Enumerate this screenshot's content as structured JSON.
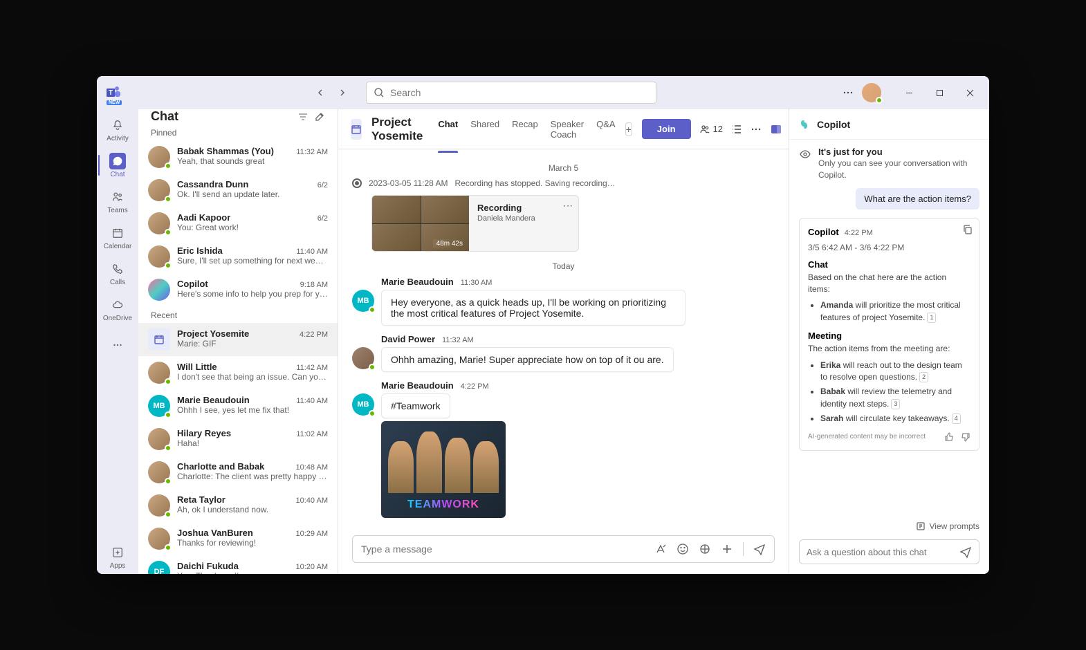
{
  "titlebar": {
    "search_placeholder": "Search",
    "new_badge": "NEW"
  },
  "rail": {
    "activity": "Activity",
    "chat": "Chat",
    "teams": "Teams",
    "calendar": "Calendar",
    "calls": "Calls",
    "onedrive": "OneDrive",
    "apps": "Apps"
  },
  "chatlist": {
    "title": "Chat",
    "sections": {
      "pinned": "Pinned",
      "recent": "Recent"
    },
    "pinned": [
      {
        "name": "Babak Shammas (You)",
        "time": "11:32 AM",
        "preview": "Yeah, that sounds great"
      },
      {
        "name": "Cassandra Dunn",
        "time": "6/2",
        "preview": "Ok. I'll send an update later."
      },
      {
        "name": "Aadi Kapoor",
        "time": "6/2",
        "preview": "You: Great work!"
      },
      {
        "name": "Eric Ishida",
        "time": "11:40 AM",
        "preview": "Sure, I'll set up something for next week t…"
      },
      {
        "name": "Copilot",
        "time": "9:18 AM",
        "preview": "Here's some info to help you prep for your…"
      }
    ],
    "recent": [
      {
        "name": "Project Yosemite",
        "time": "4:22 PM",
        "preview": "Marie: GIF"
      },
      {
        "name": "Will Little",
        "time": "11:42 AM",
        "preview": "I don't see that being an issue. Can you ta…"
      },
      {
        "name": "Marie Beaudouin",
        "time": "11:40 AM",
        "preview": "Ohhh I see, yes let me fix that!",
        "initials": "MB"
      },
      {
        "name": "Hilary Reyes",
        "time": "11:02 AM",
        "preview": "Haha!"
      },
      {
        "name": "Charlotte and Babak",
        "time": "10:48 AM",
        "preview": "Charlotte: The client was pretty happy with…"
      },
      {
        "name": "Reta Taylor",
        "time": "10:40 AM",
        "preview": "Ah, ok I understand now."
      },
      {
        "name": "Joshua VanBuren",
        "time": "10:29 AM",
        "preview": "Thanks for reviewing!"
      },
      {
        "name": "Daichi Fukuda",
        "time": "10:20 AM",
        "preview": "You: Thank you!!",
        "initials": "DF"
      }
    ]
  },
  "main": {
    "title": "Project Yosemite",
    "tabs": {
      "chat": "Chat",
      "shared": "Shared",
      "recap": "Recap",
      "coach": "Speaker Coach",
      "qa": "Q&A"
    },
    "join": "Join",
    "participant_count": "12",
    "date_march": "March 5",
    "date_today": "Today",
    "recording": {
      "timestamp": "2023-03-05 11:28 AM",
      "status": "Recording has stopped. Saving recording…",
      "title": "Recording",
      "author": "Daniela Mandera",
      "duration": "48m 42s"
    },
    "messages": [
      {
        "sender": "Marie Beaudouin",
        "time": "11:30 AM",
        "text": "Hey everyone, as a quick heads up, I'll be working on prioritizing the most critical features of Project Yosemite.",
        "avatar": "MB"
      },
      {
        "sender": "David Power",
        "time": "11:32 AM",
        "text": "Ohhh amazing, Marie! Super appreciate how on top of it ou are."
      },
      {
        "sender": "Marie Beaudouin",
        "time": "4:22 PM",
        "text": "#Teamwork",
        "avatar": "MB",
        "gif": "TEAMWORK"
      }
    ],
    "compose_placeholder": "Type a message"
  },
  "copilot": {
    "title": "Copilot",
    "privacy_title": "It's just for you",
    "privacy_text": "Only you can see your conversation with Copilot.",
    "user_prompt": "What are the action items?",
    "response": {
      "name": "Copilot",
      "time": "4:22 PM",
      "daterange": "3/5 6:42 AM - 3/6 4:22 PM",
      "chat_title": "Chat",
      "chat_intro": "Based on the chat here are the action items:",
      "chat_items": [
        {
          "bold": "Amanda",
          "text": " will prioritize the most critical features of project Yosemite.",
          "ref": "1"
        }
      ],
      "meeting_title": "Meeting",
      "meeting_intro": "The action items from the meeting are:",
      "meeting_items": [
        {
          "bold": "Erika",
          "text": " will reach out to the design team to resolve open questions.",
          "ref": "2"
        },
        {
          "bold": "Babak",
          "text": " will review the telemetry and identity next steps.",
          "ref": "3"
        },
        {
          "bold": "Sarah",
          "text": " will circulate key takeaways.",
          "ref": "4"
        }
      ],
      "disclaimer": "AI-generated content may be incorrect"
    },
    "view_prompts": "View prompts",
    "compose_placeholder": "Ask a question about this chat"
  }
}
